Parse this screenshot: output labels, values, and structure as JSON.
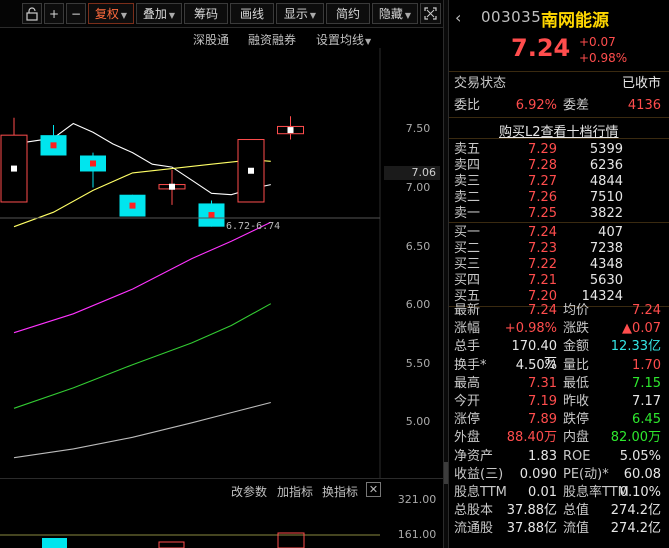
{
  "toolbar": {
    "items": [
      {
        "label": "+"
      },
      {
        "label": "−"
      },
      {
        "label": "复权"
      },
      {
        "label": "叠加"
      },
      {
        "label": "筹码"
      },
      {
        "label": "画线"
      },
      {
        "label": "显示"
      },
      {
        "label": "简约"
      },
      {
        "label": "隐藏"
      }
    ],
    "icons": [
      "lock-icon",
      "fullscreen-icon"
    ]
  },
  "chart_links": {
    "shenguotong": "深股通",
    "margin": "融资融券",
    "ma_settings": "设置均线"
  },
  "price_axis": {
    "ticks": [
      "7.50",
      "7.00",
      "6.50",
      "6.00",
      "5.50",
      "5.00"
    ],
    "current": "7.06",
    "range_label": "6.72-6.74"
  },
  "indicator_bar": {
    "params": "改参数",
    "add": "加指标",
    "switch": "换指标",
    "close": "✕"
  },
  "volume_axis": {
    "ticks": [
      "321.00",
      "161.00"
    ]
  },
  "chart_data": {
    "type": "candlestick",
    "ylim": [
      4.82,
      7.78
    ],
    "candles": [
      {
        "open": 6.72,
        "close": 7.18,
        "high": 7.3,
        "low": 6.72,
        "color": "red"
      },
      {
        "open": 7.04,
        "close": 7.18,
        "high": 7.25,
        "low": 7.04,
        "color": "cyan"
      },
      {
        "open": 6.93,
        "close": 7.04,
        "high": 7.06,
        "low": 6.82,
        "color": "cyan"
      },
      {
        "open": 6.62,
        "close": 6.77,
        "high": 6.77,
        "low": 6.62,
        "color": "cyan"
      },
      {
        "open": 6.81,
        "close": 6.84,
        "high": 6.94,
        "low": 6.7,
        "color": "red"
      },
      {
        "open": 6.55,
        "close": 6.71,
        "high": 6.73,
        "low": 6.55,
        "color": "cyan"
      },
      {
        "open": 6.72,
        "close": 7.15,
        "high": 7.15,
        "low": 6.72,
        "color": "red"
      },
      {
        "open": 7.19,
        "close": 7.24,
        "high": 7.31,
        "low": 7.15,
        "color": "red"
      }
    ],
    "ma_lines": [
      {
        "color": "#ffffff",
        "points": [
          [
            0,
            7.12
          ],
          [
            2,
            7.16
          ],
          [
            3,
            7.26
          ],
          [
            4,
            7.2
          ],
          [
            5,
            7.12
          ],
          [
            6,
            7.06
          ],
          [
            7,
            6.98
          ],
          [
            8,
            6.96
          ],
          [
            9,
            6.87
          ],
          [
            10,
            6.78
          ],
          [
            11,
            6.77
          ],
          [
            12,
            6.81
          ],
          [
            13,
            6.84
          ]
        ]
      },
      {
        "color": "#ffff66",
        "points": [
          [
            0,
            6.55
          ],
          [
            2,
            6.65
          ],
          [
            4,
            6.8
          ],
          [
            6,
            6.92
          ],
          [
            8,
            6.95
          ],
          [
            10,
            6.98
          ],
          [
            12,
            7.01
          ],
          [
            13,
            7.0
          ]
        ]
      },
      {
        "color": "#ff33ff",
        "points": [
          [
            0,
            5.82
          ],
          [
            3,
            5.95
          ],
          [
            6,
            6.12
          ],
          [
            9,
            6.33
          ],
          [
            11,
            6.45
          ],
          [
            13,
            6.58
          ]
        ]
      },
      {
        "color": "#33cc33",
        "points": [
          [
            0,
            5.3
          ],
          [
            3,
            5.44
          ],
          [
            6,
            5.6
          ],
          [
            9,
            5.75
          ],
          [
            11,
            5.87
          ],
          [
            13,
            6.02
          ]
        ]
      },
      {
        "color": "#bbbbbb",
        "points": [
          [
            0,
            4.96
          ],
          [
            3,
            5.02
          ],
          [
            6,
            5.1
          ],
          [
            9,
            5.2
          ],
          [
            11,
            5.27
          ],
          [
            13,
            5.34
          ]
        ]
      }
    ]
  },
  "panel": {
    "code": "003035",
    "name": "南网能源",
    "price": "7.24",
    "change": "+0.07",
    "change_pct": "+0.98%",
    "status_label": "交易状态",
    "status_value": "已收市",
    "webi_label": "委比",
    "webi_value": "6.92%",
    "wecha_label": "委差",
    "wecha_value": "4136",
    "l2_link": "购买L2查看十档行情",
    "asks": [
      {
        "label": "卖五",
        "price": "7.29",
        "vol": "5399"
      },
      {
        "label": "卖四",
        "price": "7.28",
        "vol": "6236"
      },
      {
        "label": "卖三",
        "price": "7.27",
        "vol": "4844"
      },
      {
        "label": "卖二",
        "price": "7.26",
        "vol": "7510"
      },
      {
        "label": "卖一",
        "price": "7.25",
        "vol": "3822"
      }
    ],
    "bids": [
      {
        "label": "买一",
        "price": "7.24",
        "vol": "407"
      },
      {
        "label": "买二",
        "price": "7.23",
        "vol": "7238"
      },
      {
        "label": "买三",
        "price": "7.22",
        "vol": "4348"
      },
      {
        "label": "买四",
        "price": "7.21",
        "vol": "5630"
      },
      {
        "label": "买五",
        "price": "7.20",
        "vol": "14324"
      }
    ],
    "quote": [
      {
        "l1": "最新",
        "v1": "7.24",
        "l2": "均价",
        "v2": "7.24"
      },
      {
        "l1": "涨幅",
        "v1": "+0.98%",
        "l2": "涨跌",
        "v2": "▲0.07"
      },
      {
        "l1": "总手",
        "v1": "170.40万",
        "l2": "金额",
        "v2": "12.33亿"
      },
      {
        "l1": "换手*",
        "v1": "4.50%",
        "l2": "量比",
        "v2": "1.70"
      },
      {
        "l1": "最高",
        "v1": "7.31",
        "l2": "最低",
        "v2": "7.15"
      },
      {
        "l1": "今开",
        "v1": "7.19",
        "l2": "昨收",
        "v2": "7.17"
      },
      {
        "l1": "涨停",
        "v1": "7.89",
        "l2": "跌停",
        "v2": "6.45"
      },
      {
        "l1": "外盘",
        "v1": "88.40万",
        "l2": "内盘",
        "v2": "82.00万"
      },
      {
        "l1": "净资产",
        "v1": "1.83",
        "l2": "ROE",
        "v2": "5.05%"
      },
      {
        "l1": "收益(三)",
        "v1": "0.090",
        "l2": "PE(动)*",
        "v2": "60.08"
      },
      {
        "l1": "股息TTM",
        "v1": "0.01",
        "l2": "股息率TTM",
        "v2": "0.10%"
      },
      {
        "l1": "总股本",
        "v1": "37.88亿",
        "l2": "总值",
        "v2": "274.2亿"
      },
      {
        "l1": "流通股",
        "v1": "37.88亿",
        "l2": "流值",
        "v2": "274.2亿"
      }
    ]
  }
}
